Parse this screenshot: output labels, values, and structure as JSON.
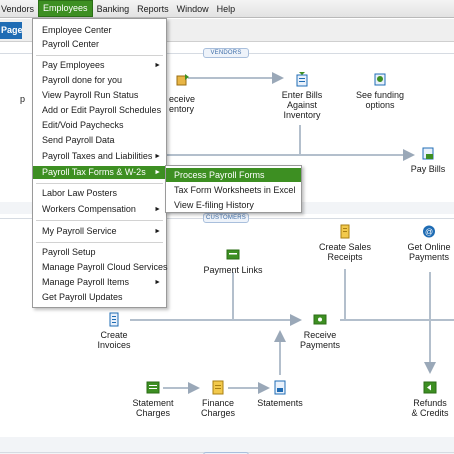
{
  "menubar": {
    "items": [
      {
        "label": "Vendors"
      },
      {
        "label": "Employees",
        "active": true
      },
      {
        "label": "Banking"
      },
      {
        "label": "Reports"
      },
      {
        "label": "Window"
      },
      {
        "label": "Help"
      }
    ]
  },
  "toolbar": {
    "page_tab": "Page"
  },
  "sections": {
    "vendors": "VENDORS",
    "customers": "CUSTOMERS"
  },
  "vendors_flow": {
    "receive_inventory": {
      "line1": "Receive",
      "line2": "Inventory",
      "prefix": "eceive",
      "prefix2": "entory"
    },
    "enter_bills": {
      "line1": "Enter Bills",
      "line2": "Against",
      "line3": "Inventory"
    },
    "funding": {
      "line1": "See funding",
      "line2": "options"
    },
    "pay_bills": "Pay Bills",
    "partial_left": "p"
  },
  "customers_flow": {
    "payment_links": "Payment Links",
    "sales_receipts": {
      "line1": "Create Sales",
      "line2": "Receipts"
    },
    "online_payments": {
      "line1": "Get Online",
      "line2": "Payments"
    },
    "create_invoices": {
      "line1": "Create",
      "line2": "Invoices"
    },
    "receive_payments": {
      "line1": "Receive",
      "line2": "Payments"
    },
    "statement_charges": {
      "line1": "Statement",
      "line2": "Charges"
    },
    "finance_charges": {
      "line1": "Finance",
      "line2": "Charges"
    },
    "statements": "Statements",
    "refunds": {
      "line1": "Refunds",
      "line2": "& Credits"
    }
  },
  "dropdown": {
    "items": [
      {
        "label": "Employee Center",
        "submenu": false
      },
      {
        "label": "Payroll Center",
        "submenu": false
      },
      {
        "sep": true
      },
      {
        "label": "Pay Employees",
        "submenu": true
      },
      {
        "label": "Payroll done for you",
        "submenu": false
      },
      {
        "label": "View Payroll Run Status",
        "submenu": false
      },
      {
        "label": "Add or Edit Payroll Schedules",
        "submenu": false
      },
      {
        "label": "Edit/Void Paychecks",
        "submenu": false
      },
      {
        "label": "Send Payroll Data",
        "submenu": false
      },
      {
        "label": "Payroll Taxes and Liabilities",
        "submenu": true
      },
      {
        "label": "Payroll Tax Forms & W-2s",
        "submenu": true,
        "highlighted": true
      },
      {
        "sep": true
      },
      {
        "label": "Labor Law Posters",
        "submenu": false
      },
      {
        "label": "Workers Compensation",
        "submenu": true
      },
      {
        "sep": true
      },
      {
        "label": "My Payroll Service",
        "submenu": true
      },
      {
        "sep": true
      },
      {
        "label": "Payroll Setup",
        "submenu": false
      },
      {
        "label": "Manage Payroll Cloud Services",
        "submenu": false
      },
      {
        "label": "Manage Payroll Items",
        "submenu": true
      },
      {
        "label": "Get Payroll Updates",
        "submenu": false
      }
    ],
    "arrow_glyph": "►"
  },
  "submenu": {
    "items": [
      {
        "label": "Process Payroll Forms",
        "highlighted": true
      },
      {
        "label": "Tax Form Worksheets in Excel"
      },
      {
        "label": "View E-filing History"
      }
    ]
  },
  "colors": {
    "menu_highlight": "#3d8f22",
    "page_tab": "#1f6cb4",
    "section_tag": "#3f6ea8"
  }
}
